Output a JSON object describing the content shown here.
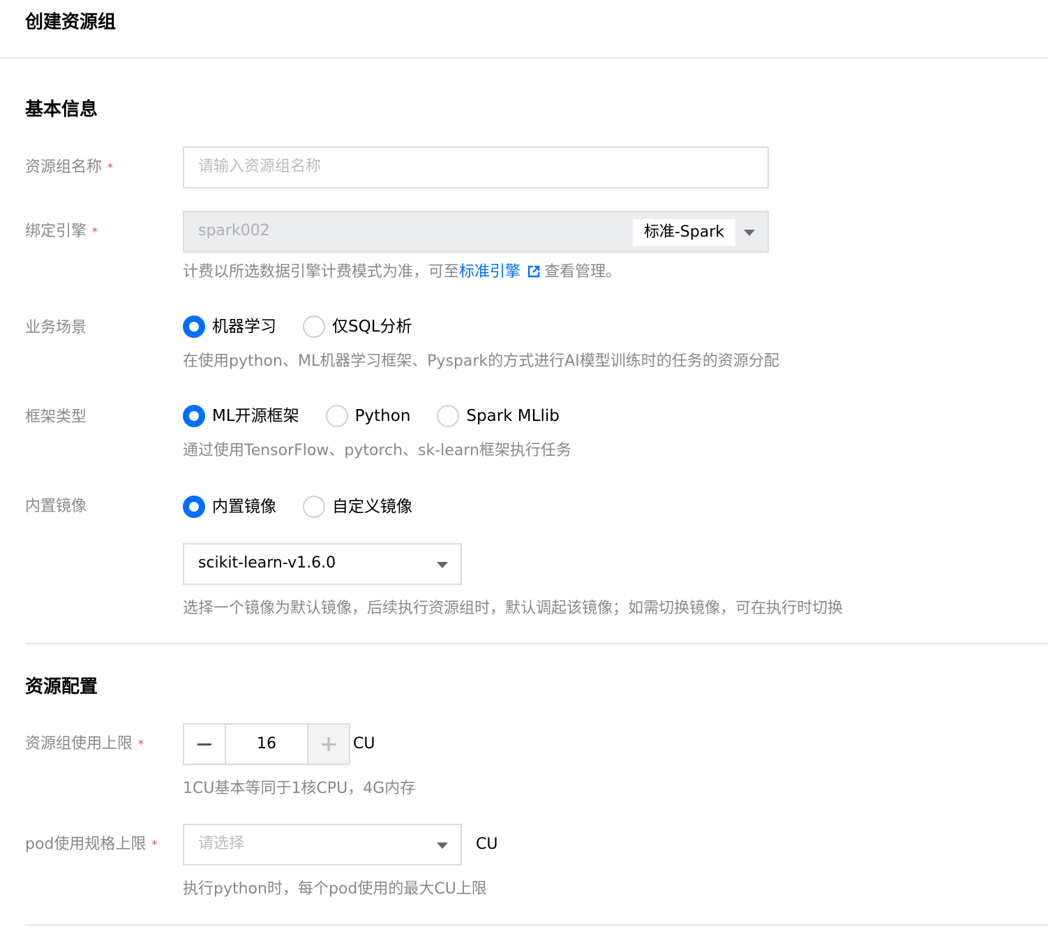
{
  "page": {
    "title": "创建资源组"
  },
  "basic": {
    "section_title": "基本信息",
    "name": {
      "label": "资源组名称",
      "required": "*",
      "placeholder": "请输入资源组名称"
    },
    "engine": {
      "label": "绑定引擎",
      "required": "*",
      "value": "spark002",
      "tag": "标准-Spark",
      "hint_prefix": "计费以所选数据引擎计费模式为准，可至",
      "hint_link": "标准引擎",
      "hint_suffix": "查看管理。"
    },
    "scenario": {
      "label": "业务场景",
      "options": [
        "机器学习",
        "仅SQL分析"
      ],
      "selected": "机器学习",
      "hint": "在使用python、ML机器学习框架、Pyspark的方式进行AI模型训练时的任务的资源分配"
    },
    "framework": {
      "label": "框架类型",
      "options": [
        "ML开源框架",
        "Python",
        "Spark MLlib"
      ],
      "selected": "ML开源框架",
      "hint": "通过使用TensorFlow、pytorch、sk-learn框架执行任务"
    },
    "image": {
      "label": "内置镜像",
      "options": [
        "内置镜像",
        "自定义镜像"
      ],
      "selected": "内置镜像",
      "select_value": "scikit-learn-v1.6.0",
      "hint": "选择一个镜像为默认镜像，后续执行资源组时，默认调起该镜像；如需切换镜像，可在执行时切换"
    }
  },
  "resource": {
    "section_title": "资源配置",
    "limit": {
      "label": "资源组使用上限",
      "required": "*",
      "value": "16",
      "unit": "CU",
      "hint": "1CU基本等同于1核CPU，4G内存"
    },
    "pod": {
      "label": "pod使用规格上限",
      "required": "*",
      "placeholder": "请选择",
      "unit": "CU",
      "hint": "执行python时，每个pod使用的最大CU上限"
    }
  },
  "colors": {
    "accent": "#006eff",
    "required": "#e54545",
    "muted": "#888888",
    "border": "#dcdcdc"
  },
  "icons": {
    "external_link": "external-link-icon",
    "caret": "caret-down-icon",
    "minus": "minus-icon",
    "plus": "plus-icon"
  }
}
